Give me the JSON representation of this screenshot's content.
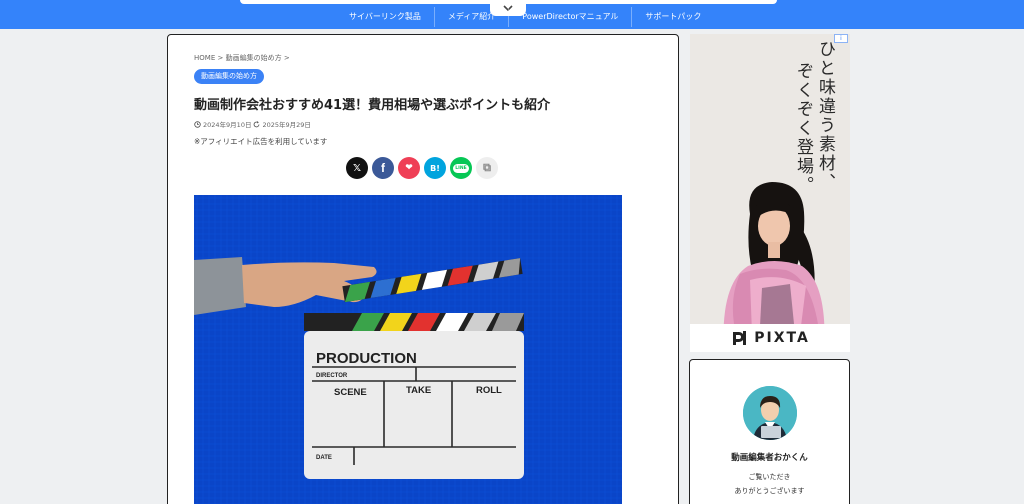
{
  "nav": {
    "items": [
      {
        "label": "サイバーリンク製品"
      },
      {
        "label": "メディア紹介"
      },
      {
        "label": "PowerDirectorマニュアル"
      },
      {
        "label": "サポートパック"
      }
    ],
    "toggle_icon": "chevron-down-icon"
  },
  "article": {
    "breadcrumb": {
      "home": "HOME",
      "sep": ">",
      "category": "動画編集の始め方"
    },
    "category_badge": "動画編集の始め方",
    "title": "動画制作会社おすすめ41選！費用相場や選ぶポイントも紹介",
    "published": "2024年9月10日",
    "updated": "2025年9月29日",
    "disclaimer": "※アフィリエイト広告を利用しています",
    "share": [
      {
        "icon": "x-icon",
        "glyph": "𝕏",
        "color": "#111111"
      },
      {
        "icon": "facebook-icon",
        "glyph": "f",
        "color": "#3b5998"
      },
      {
        "icon": "pocket-icon",
        "glyph": "❤",
        "color": "#ef3f56"
      },
      {
        "icon": "hatena-icon",
        "glyph": "B!",
        "color": "#00a4de"
      },
      {
        "icon": "line-icon",
        "glyph": "LINE",
        "color": "#06c755"
      },
      {
        "icon": "copy-icon",
        "glyph": "⧉",
        "color": "#eeeeee"
      }
    ],
    "hero": {
      "board_title": "PRODUCTION",
      "director": "DIRECTOR",
      "scene": "SCENE",
      "take": "TAKE",
      "roll": "ROLL",
      "date": "DATE",
      "bg_color": "#0a45c8"
    }
  },
  "sidebar": {
    "ad": {
      "info": "i",
      "line1": "ひと味違う素材、",
      "line2": "ぞくぞく登場。",
      "brand": "PIXTA"
    },
    "profile": {
      "name": "動画編集者おかくん",
      "message_line1": "ご覧いただき",
      "message_line2": "ありがとうございます"
    }
  }
}
